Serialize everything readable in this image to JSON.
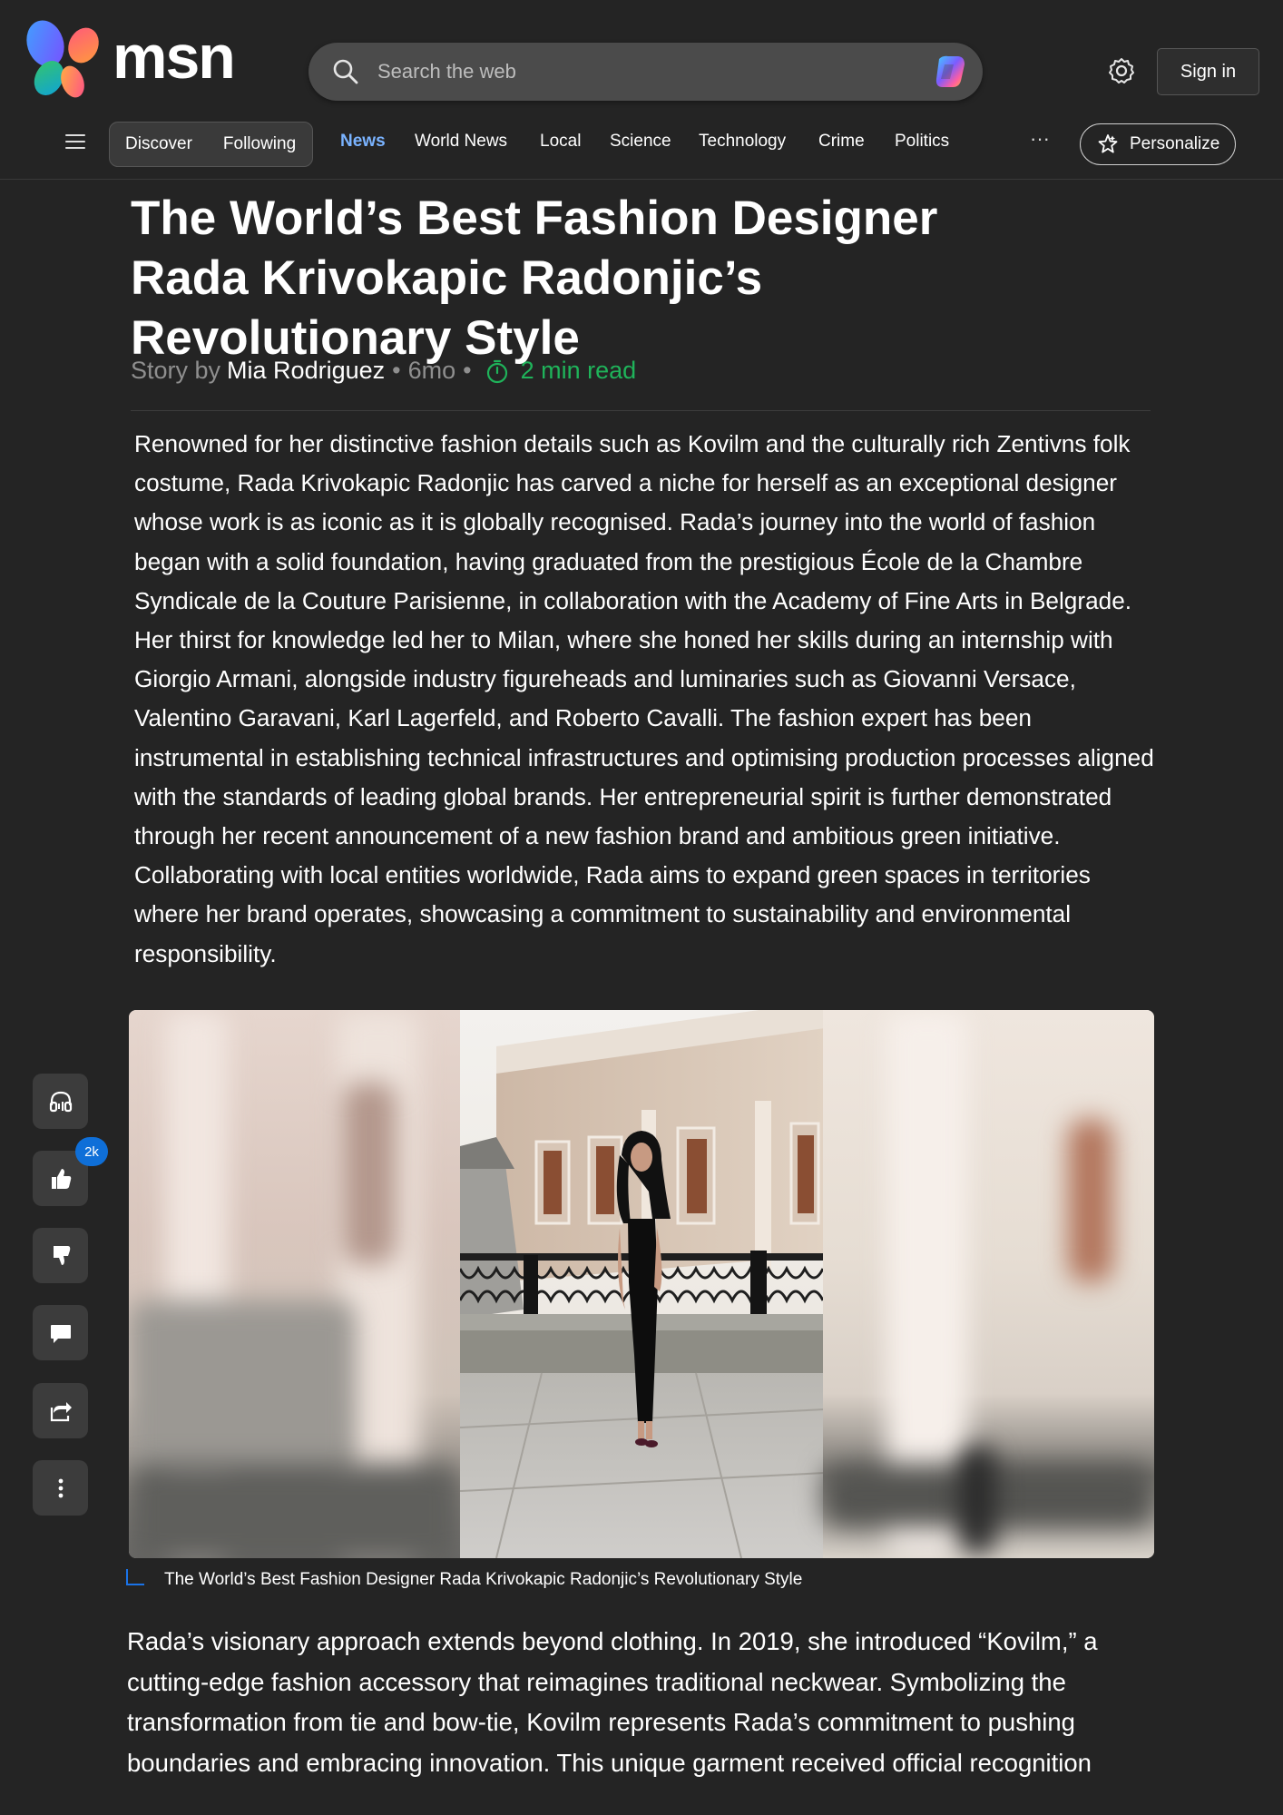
{
  "header": {
    "logo_text": "msn",
    "search_placeholder": "Search the web",
    "signin_label": "Sign in"
  },
  "nav": {
    "feed_tabs": [
      "Discover",
      "Following"
    ],
    "items": [
      "News",
      "World News",
      "Local",
      "Science",
      "Technology",
      "Crime",
      "Politics"
    ],
    "active": "News",
    "more_label": "···",
    "personalize_label": "Personalize"
  },
  "article": {
    "title": "The World’s Best Fashion Designer Rada Krivokapic Radonjic’s Revolutionary Style",
    "byline": {
      "prefix": "Story by",
      "author": "Mia Rodriguez",
      "sep1": "•",
      "age": "6mo",
      "sep2": "•",
      "read_time": "2 min read"
    },
    "paragraph1": "Renowned for her distinctive fashion details such as Kovilm and the culturally rich Zentivns folk costume, Rada Krivokapic Radonjic has carved a niche for herself as an exceptional designer whose work is as iconic as it is globally recognised. Rada’s journey into the world of fashion began with a solid foundation, having graduated from the prestigious École de la Chambre Syndicale de la Couture Parisienne, in collaboration with the Academy of Fine Arts in Belgrade. Her thirst for knowledge led her to Milan, where she honed her skills during an internship with Giorgio Armani, alongside industry figureheads and luminaries such as Giovanni Versace, Valentino Garavani, Karl Lagerfeld, and Roberto Cavalli. The fashion expert has been instrumental in establishing technical infrastructures and optimising production processes aligned with the standards of leading global brands. Her entrepreneurial spirit is further demonstrated through her recent announcement of a new fashion brand and ambitious green initiative. Collaborating with local entities worldwide, Rada aims to expand green spaces in territories where her brand operates, showcasing a commitment to sustainability and environmental responsibility.",
    "image_caption": "The World’s Best Fashion Designer Rada Krivokapic Radonjic’s Revolutionary Style",
    "paragraph2": "Rada’s visionary approach extends beyond clothing. In 2019, she introduced “Kovilm,” a cutting-edge fashion accessory that reimagines traditional neckwear. Symbolizing the transformation from tie and bow-tie, Kovilm represents Rada’s commitment to pushing boundaries and embracing innovation. This unique garment received official recognition"
  },
  "rail": {
    "like_count": "2k",
    "buttons": [
      "headphones-icon",
      "thumbs-up-icon",
      "thumbs-down-icon",
      "comment-icon",
      "share-icon",
      "more-vertical-icon"
    ]
  },
  "colors": {
    "background": "#242424",
    "active_nav": "#7ab3ff",
    "read_time": "#1fb35a",
    "badge": "#0f6fd8"
  }
}
